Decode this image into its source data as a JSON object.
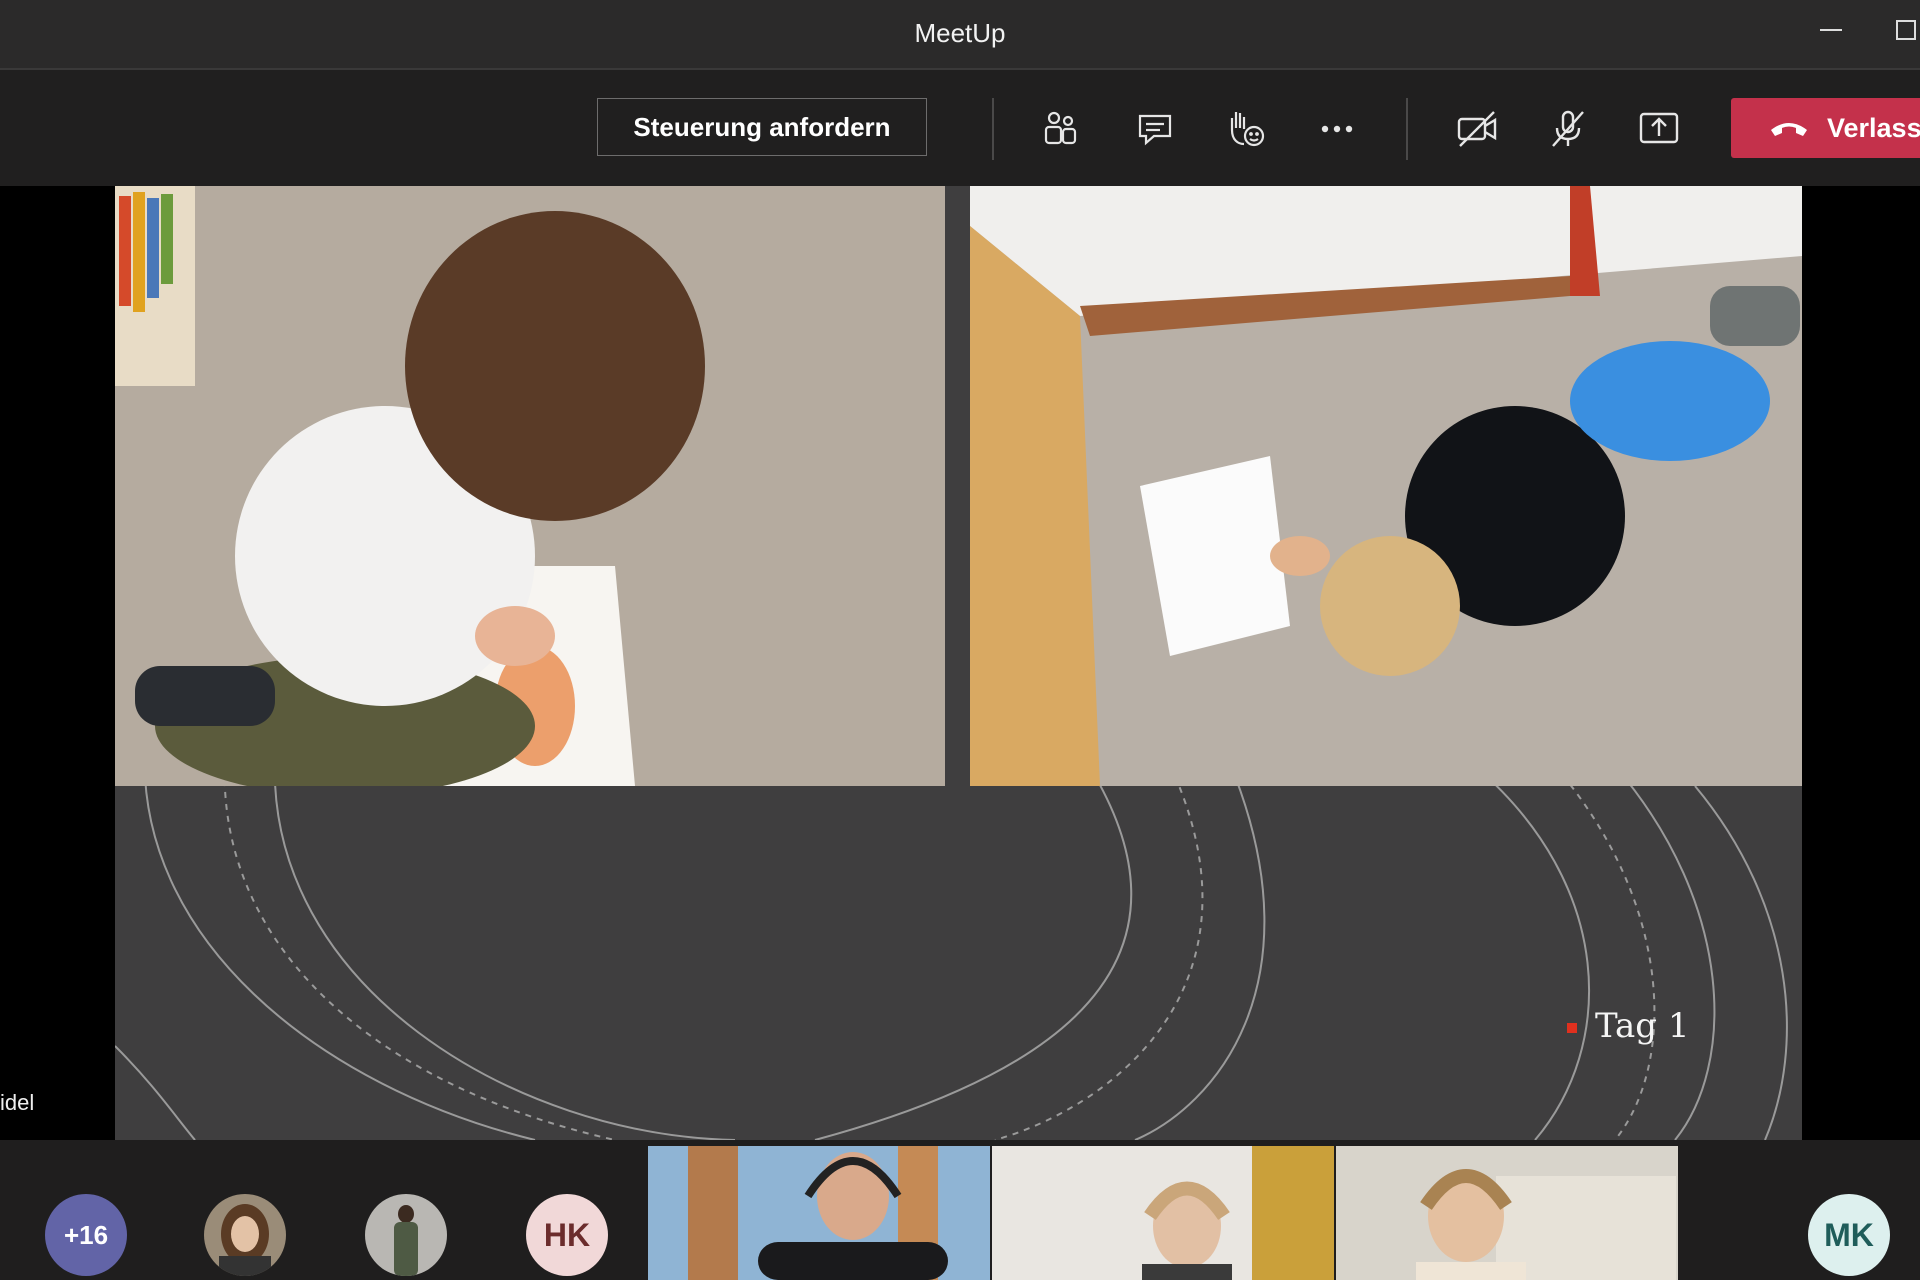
{
  "window": {
    "title": "MeetUp"
  },
  "toolbar": {
    "request_control_label": "Steuerung anfordern",
    "leave_label": "Verlassen",
    "icons": [
      "participants-icon",
      "chat-icon",
      "raise-hand-icon",
      "more-options-icon",
      "camera-off-icon",
      "mic-off-icon",
      "share-screen-icon",
      "phone-hangup-icon"
    ],
    "leave_color": "#c4314b"
  },
  "shared_content": {
    "slide_label": "Tag 1",
    "presenter_name_fragment": "idel",
    "accent_color": "#e0301e",
    "photos": [
      "child-drawing-kneeling-photo",
      "child-drawing-lying-photo"
    ]
  },
  "participants": {
    "more_count": "+16",
    "avatars": [
      {
        "type": "photo",
        "name": "participant-avatar-1"
      },
      {
        "type": "photo",
        "name": "participant-avatar-2"
      },
      {
        "type": "initials",
        "initials": "HK"
      },
      {
        "type": "initials",
        "initials": "MK"
      }
    ],
    "video_tiles": 3
  }
}
